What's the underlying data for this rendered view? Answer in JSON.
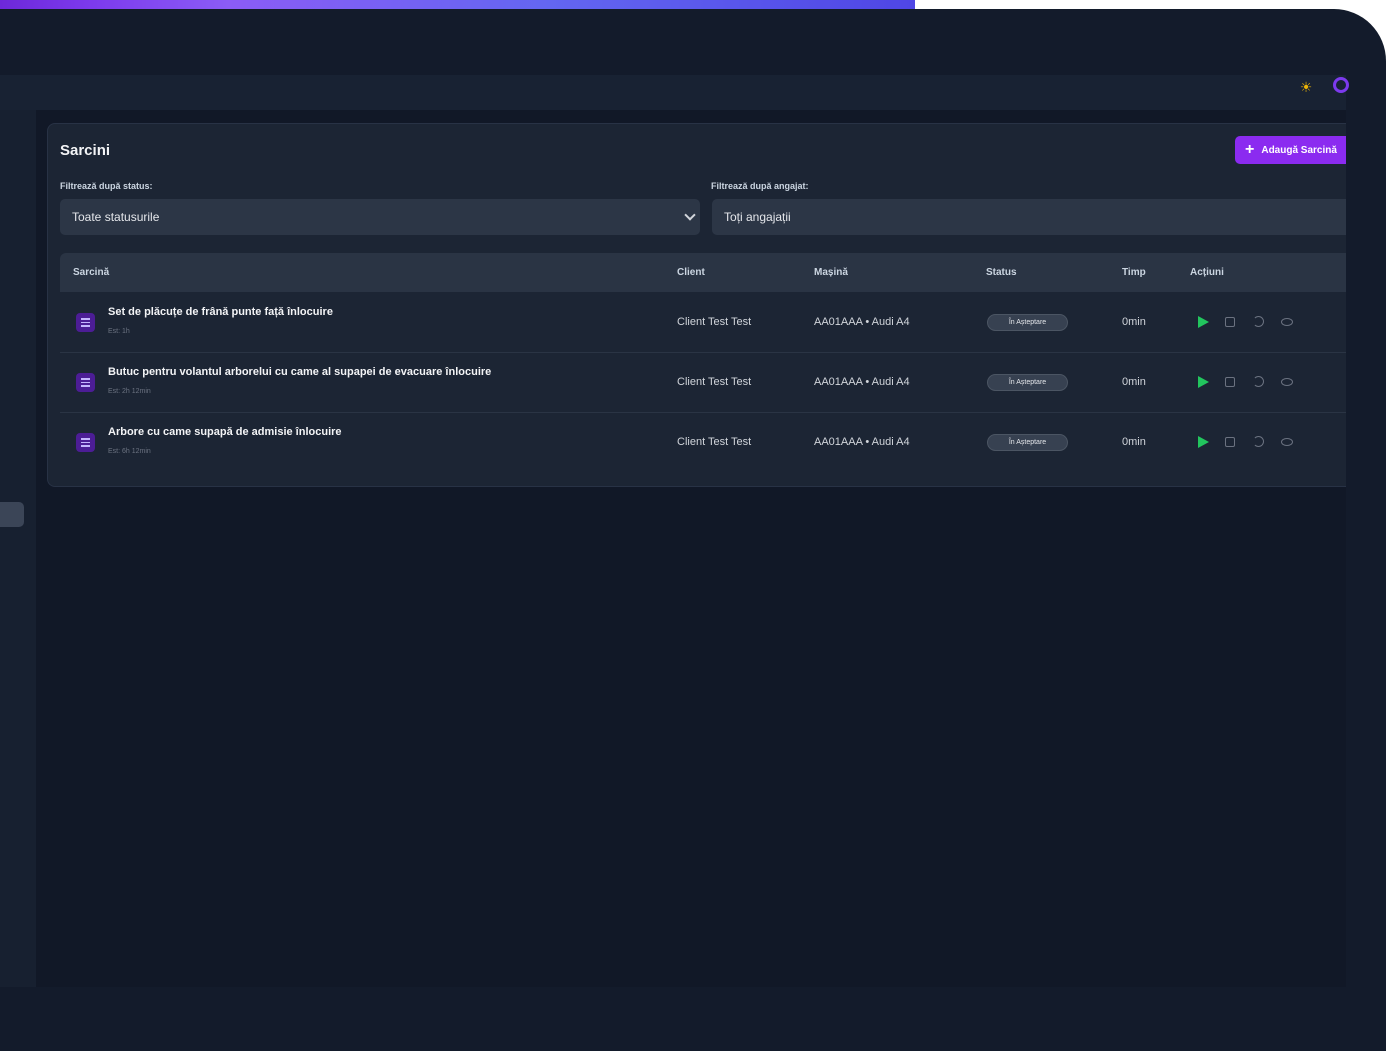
{
  "header": {
    "theme_icon": "sun-icon",
    "avatar_icon": "user-avatar-icon"
  },
  "page": {
    "title": "Sarcini",
    "add_button": {
      "label": "Adaugă Sarcină",
      "icon": "plus-icon"
    }
  },
  "filters": {
    "status": {
      "label": "Filtrează după status:",
      "value": "Toate statusurile"
    },
    "employee": {
      "label": "Filtrează după angajat:",
      "value": "Toți angajații"
    }
  },
  "table": {
    "columns": [
      "Sarcină",
      "Client",
      "Mașină",
      "Status",
      "Timp",
      "Acțiuni"
    ],
    "rows": [
      {
        "title": "Set de plăcuțe de frână punte față înlocuire",
        "estimate": "Est: 1h",
        "client": "Client Test Test",
        "car": "AA01AAA • Audi A4",
        "status": "În Așteptare",
        "time": "0min"
      },
      {
        "title": "Butuc pentru volantul arborelui cu came al supapei de evacuare înlocuire",
        "estimate": "Est: 2h 12min",
        "client": "Client Test Test",
        "car": "AA01AAA • Audi A4",
        "status": "În Așteptare",
        "time": "0min"
      },
      {
        "title": "Arbore cu came supapă de admisie înlocuire",
        "estimate": "Est: 6h 12min",
        "client": "Client Test Test",
        "car": "AA01AAA • Audi A4",
        "status": "În Așteptare",
        "time": "0min"
      }
    ]
  },
  "colors": {
    "accent": "#8b2bf0",
    "play": "#22c55e",
    "background": "#131b2b",
    "card": "#1c2534"
  }
}
